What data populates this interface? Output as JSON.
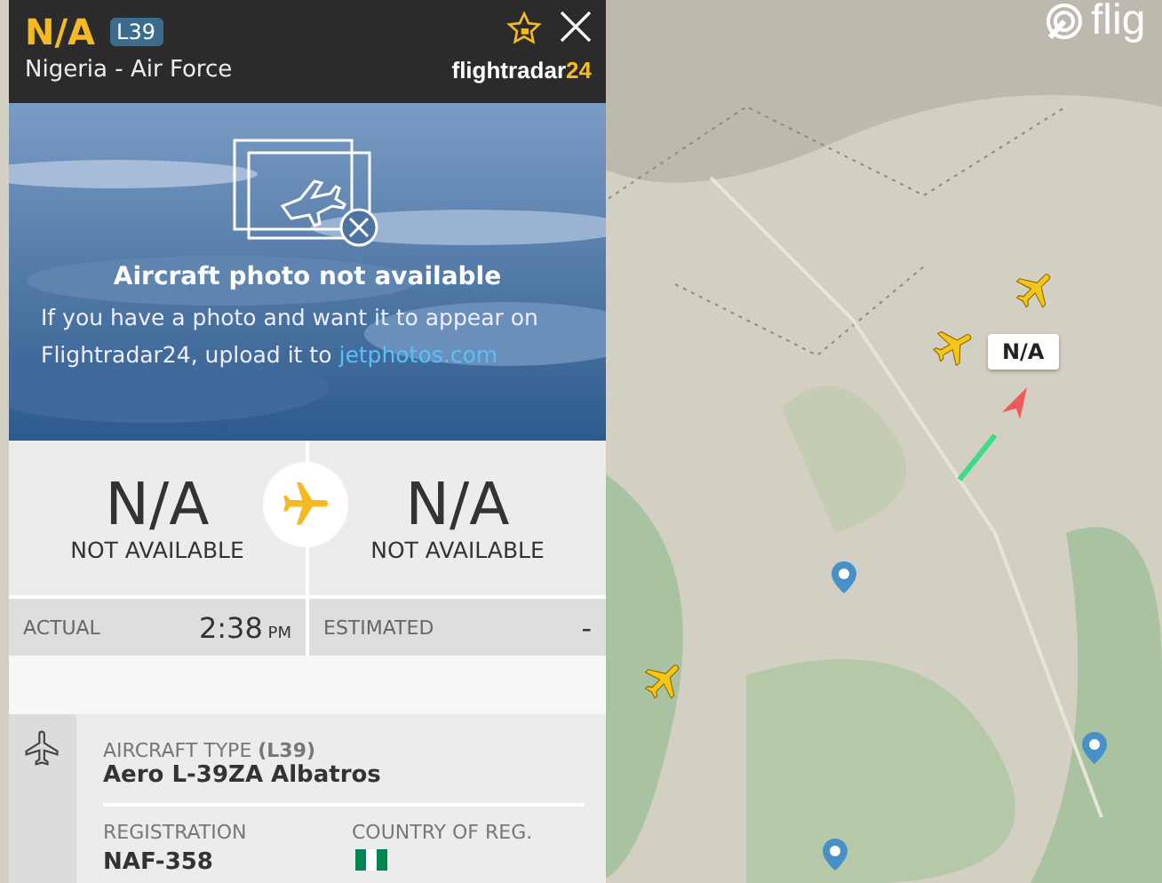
{
  "map": {
    "kind": "picture",
    "logo": "flig",
    "selected_label": "N/A"
  },
  "header": {
    "callsign": "N/A",
    "type_badge": "L39",
    "operator": "Nigeria - Air Force",
    "brand": "flightradar",
    "brand_suffix": "24"
  },
  "photo": {
    "kind": "picture",
    "title": "Aircraft photo not available",
    "message": "If you have a photo and want it to appear on Flightradar24, upload it to",
    "link": "jetphotos.com"
  },
  "route": [
    {
      "code": "N/A",
      "name": "NOT AVAILABLE"
    },
    {
      "code": "N/A",
      "name": "NOT AVAILABLE"
    }
  ],
  "times": [
    {
      "label": "ACTUAL",
      "value": "2:38",
      "suffix": "PM"
    },
    {
      "label": "ESTIMATED",
      "value": "-"
    }
  ],
  "aircraft": {
    "type_label": "AIRCRAFT TYPE",
    "type_code": "(L39)",
    "type": "Aero L-39ZA Albatros",
    "registration_label": "REGISTRATION",
    "registration": "NAF-358",
    "country_label": "COUNTRY OF REG."
  }
}
